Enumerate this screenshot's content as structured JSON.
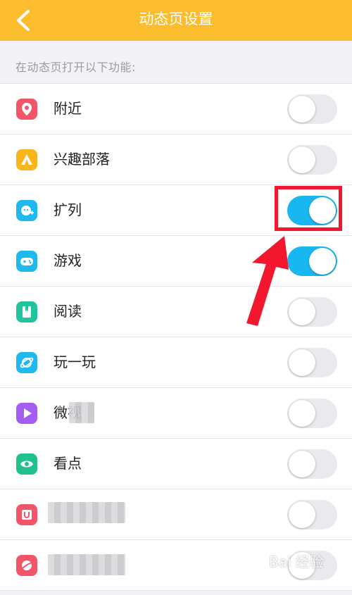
{
  "header": {
    "title": "动态页设置",
    "background": "#fbbd2e"
  },
  "section_label": "在动态页打开以下功能:",
  "items": [
    {
      "label": "附近",
      "icon": "location-pin-icon",
      "icon_color": "#f05568",
      "enabled": false
    },
    {
      "label": "兴趣部落",
      "icon": "tent-icon",
      "icon_color": "#f8b51c",
      "enabled": false
    },
    {
      "label": "扩列",
      "icon": "face-plus-icon",
      "icon_color": "#1eb9ee",
      "enabled": true
    },
    {
      "label": "游戏",
      "icon": "gamepad-icon",
      "icon_color": "#1eb9ee",
      "enabled": true
    },
    {
      "label": "阅读",
      "icon": "book-icon",
      "icon_color": "#22c49e",
      "enabled": false
    },
    {
      "label": "玩一玩",
      "icon": "planet-icon",
      "icon_color": "#1eb9ee",
      "enabled": false
    },
    {
      "label": "微视",
      "icon": "play-icon",
      "icon_color": "#a45cf2",
      "enabled": false
    },
    {
      "label": "看点",
      "icon": "eye-icon",
      "icon_color": "#20c08f",
      "enabled": false
    },
    {
      "label": "",
      "icon": "shop-bag-icon",
      "icon_color": "#f05568",
      "enabled": false
    },
    {
      "label": "",
      "icon": "sport-icon",
      "icon_color": "#f05568",
      "enabled": false
    }
  ],
  "toggle_on_color": "#19b7f0",
  "watermark": "Bai 经验"
}
